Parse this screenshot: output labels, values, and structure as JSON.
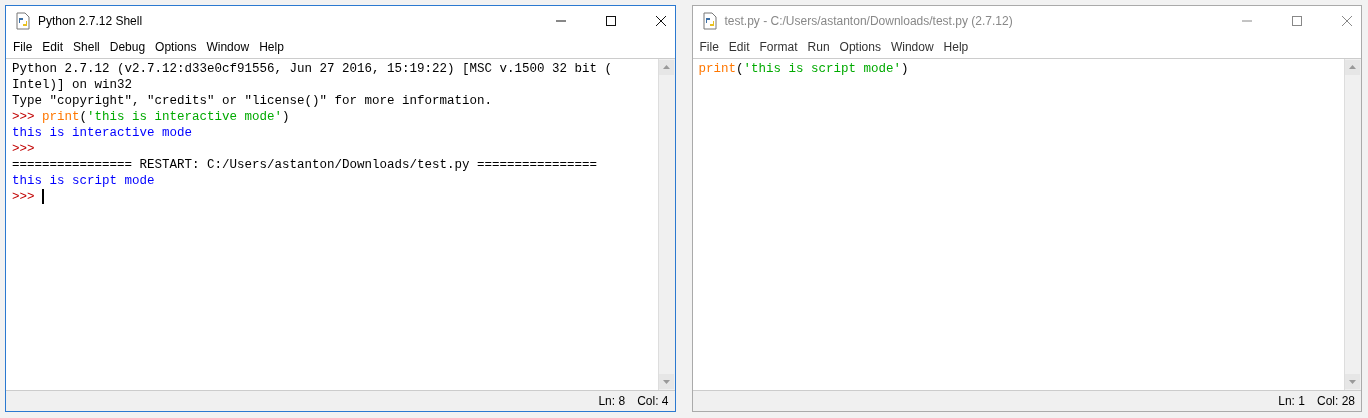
{
  "windows": [
    {
      "title": "Python 2.7.12 Shell",
      "active": true,
      "menu": [
        "File",
        "Edit",
        "Shell",
        "Debug",
        "Options",
        "Window",
        "Help"
      ],
      "lines": [
        [
          {
            "kind": "plain",
            "text": "Python 2.7.12 (v2.7.12:d33e0cf91556, Jun 27 2016, 15:19:22) [MSC v.1500 32 bit ("
          }
        ],
        [
          {
            "kind": "plain",
            "text": "Intel)] on win32"
          }
        ],
        [
          {
            "kind": "plain",
            "text": "Type \"copyright\", \"credits\" or \"license()\" for more information."
          }
        ],
        [
          {
            "kind": "prompt",
            "text": ">>> "
          },
          {
            "kind": "builtin",
            "text": "print"
          },
          {
            "kind": "plain",
            "text": "("
          },
          {
            "kind": "string",
            "text": "'this is interactive mode'"
          },
          {
            "kind": "plain",
            "text": ")"
          }
        ],
        [
          {
            "kind": "output",
            "text": "this is interactive mode"
          }
        ],
        [
          {
            "kind": "prompt",
            "text": ">>>"
          }
        ],
        [
          {
            "kind": "plain",
            "text": "================ RESTART: C:/Users/astanton/Downloads/test.py ================"
          }
        ],
        [
          {
            "kind": "output",
            "text": "this is script mode"
          }
        ],
        [
          {
            "kind": "prompt",
            "text": ">>> "
          }
        ]
      ],
      "cursor": true,
      "status": {
        "line": "Ln: 8",
        "col": "Col: 4"
      }
    },
    {
      "title": "test.py - C:/Users/astanton/Downloads/test.py (2.7.12)",
      "active": false,
      "menu": [
        "File",
        "Edit",
        "Format",
        "Run",
        "Options",
        "Window",
        "Help"
      ],
      "lines": [
        [
          {
            "kind": "builtin",
            "text": "print"
          },
          {
            "kind": "plain",
            "text": "("
          },
          {
            "kind": "string",
            "text": "'this is script mode'"
          },
          {
            "kind": "plain",
            "text": ")"
          }
        ]
      ],
      "cursor": false,
      "status": {
        "line": "Ln: 1",
        "col": "Col: 28"
      }
    }
  ]
}
